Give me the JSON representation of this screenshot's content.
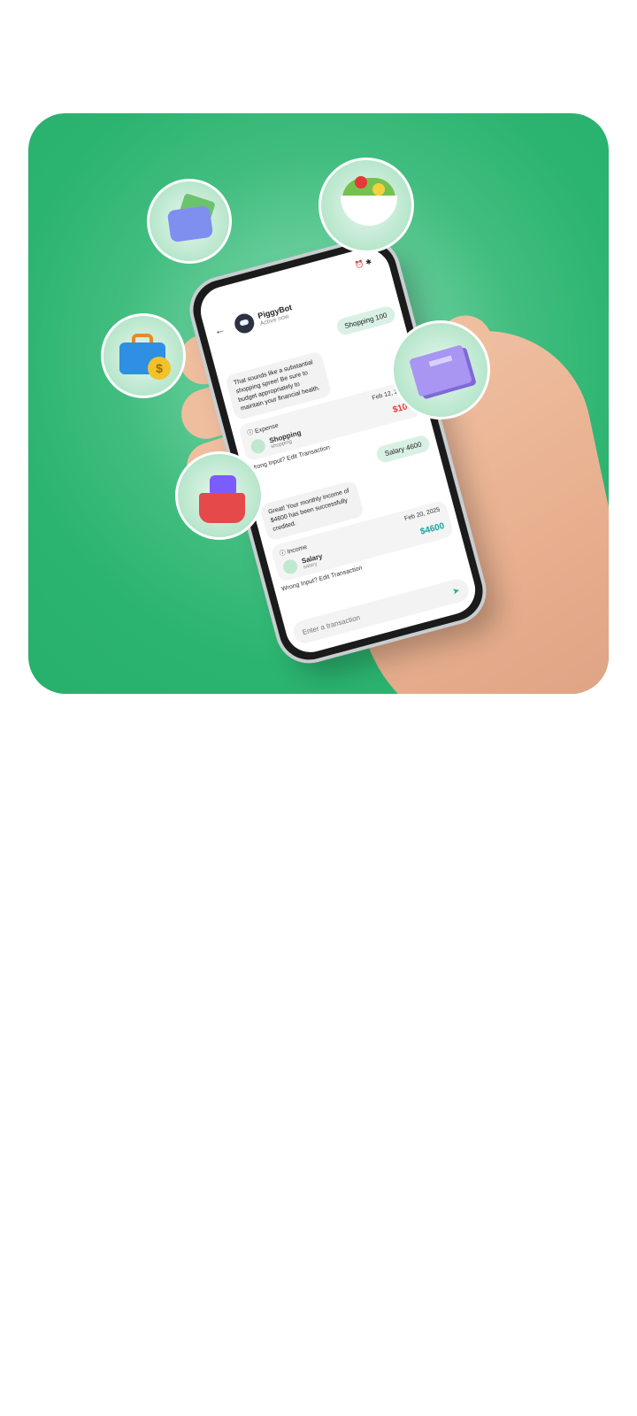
{
  "colors": {
    "hero_bg": "#2bb46f",
    "expense": "#e53935",
    "income": "#1aa4a0"
  },
  "icons": [
    "wallet-icon",
    "salad-icon",
    "briefcase-coin-icon",
    "book-icon",
    "shopping-basket-icon",
    "back-arrow-icon",
    "send-icon",
    "alarm-icon",
    "bluetooth-icon",
    "info-icon"
  ],
  "phone": {
    "chat": {
      "title": "PiggyBot",
      "status": "Active now",
      "messages": {
        "user1": "Shopping 100",
        "bot1": "That sounds like a substantial shopping spree! Be sure to budget appropriately to maintain your financial health.",
        "txn1": {
          "type": "Expense",
          "date": "Feb 12, 2025",
          "category": "Shopping",
          "subcategory": "shopping",
          "amount": "$100"
        },
        "edit1": "Wrong Input? Edit Transaction",
        "user2": "Salary 4600",
        "bot2": "Great! Your monthly income of $4600 has been successfully credited.",
        "txn2": {
          "type": "Income",
          "date": "Feb 20, 2025",
          "category": "Salary",
          "subcategory": "salary",
          "amount": "$4600"
        },
        "edit2": "Wrong Input? Edit Transaction"
      },
      "composer_placeholder": "Enter a transaction"
    }
  }
}
